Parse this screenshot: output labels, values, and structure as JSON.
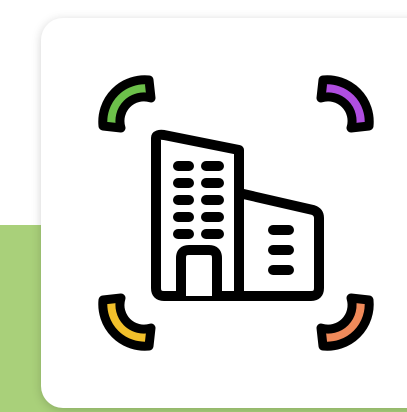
{
  "icon": {
    "name": "building-scan-icon",
    "colors": {
      "outline": "#000000",
      "corner_top_left": "#6cc04a",
      "corner_top_right": "#b04ee0",
      "corner_bottom_left": "#f2c02b",
      "corner_bottom_right": "#f08a5a",
      "background_band": "#a9d07a",
      "card": "#ffffff"
    }
  }
}
